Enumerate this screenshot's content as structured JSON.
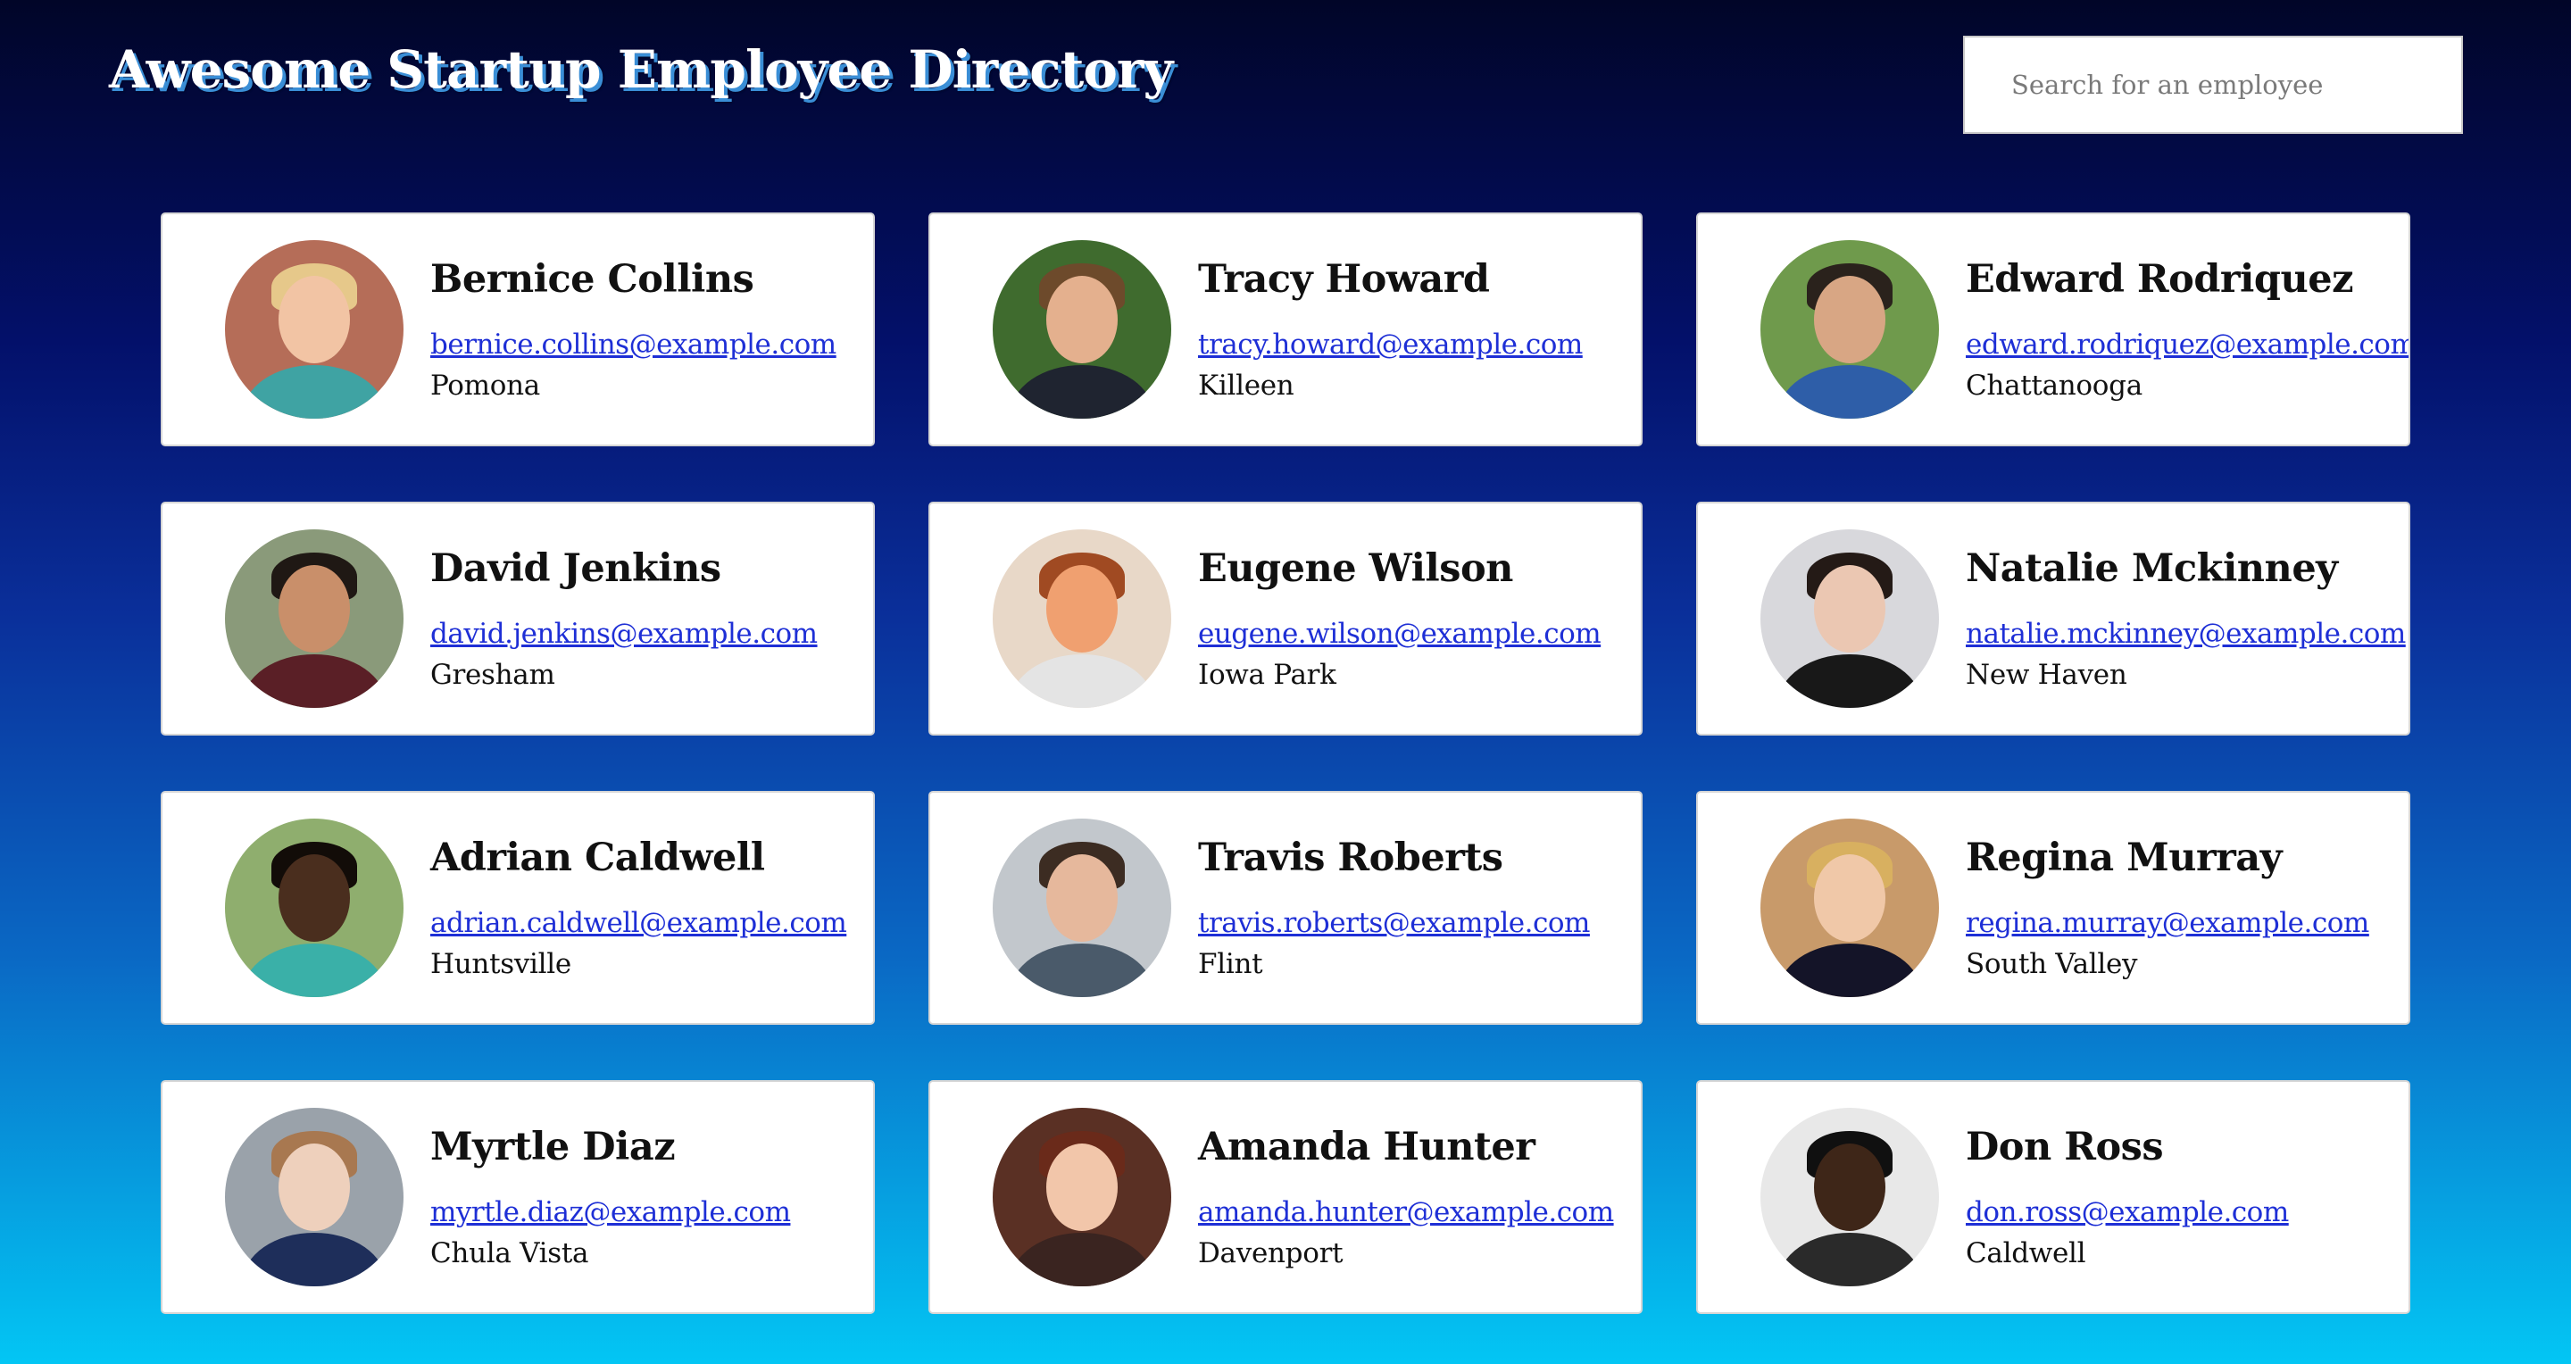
{
  "header": {
    "title": "Awesome Startup Employee Directory",
    "search_placeholder": "Search for an employee"
  },
  "employees": [
    {
      "name": "Bernice Collins",
      "email": "bernice.collins@example.com",
      "city": "Pomona",
      "bg": "#b56d58",
      "skin": "#f2c4a4",
      "hair": "#e6c88a",
      "shirt": "#3fa3a3"
    },
    {
      "name": "Tracy Howard",
      "email": "tracy.howard@example.com",
      "city": "Killeen",
      "bg": "#3f6b2e",
      "skin": "#e4b08e",
      "hair": "#6d4a2b",
      "shirt": "#1f2430"
    },
    {
      "name": "Edward Rodriquez",
      "email": "edward.rodriquez@example.com",
      "city": "Chattanooga",
      "bg": "#6f9a4c",
      "skin": "#d8a684",
      "hair": "#2a221c",
      "shirt": "#2e5ea8"
    },
    {
      "name": "David Jenkins",
      "email": "david.jenkins@example.com",
      "city": "Gresham",
      "bg": "#8a9a7a",
      "skin": "#c98f6a",
      "hair": "#1f1814",
      "shirt": "#5a1f26"
    },
    {
      "name": "Eugene Wilson",
      "email": "eugene.wilson@example.com",
      "city": "Iowa Park",
      "bg": "#e8d8c8",
      "skin": "#f0a070",
      "hair": "#a04a22",
      "shirt": "#e4e4e4"
    },
    {
      "name": "Natalie Mckinney",
      "email": "natalie.mckinney@example.com",
      "city": "New Haven",
      "bg": "#d8d8dc",
      "skin": "#ebc7b2",
      "hair": "#241a16",
      "shirt": "#181818"
    },
    {
      "name": "Adrian Caldwell",
      "email": "adrian.caldwell@example.com",
      "city": "Huntsville",
      "bg": "#8fae6e",
      "skin": "#4a2e1e",
      "hair": "#120c08",
      "shirt": "#3ab0a8"
    },
    {
      "name": "Travis Roberts",
      "email": "travis.roberts@example.com",
      "city": "Flint",
      "bg": "#c2c7cc",
      "skin": "#e6b89c",
      "hair": "#3c2c22",
      "shirt": "#4a5a6a"
    },
    {
      "name": "Regina Murray",
      "email": "regina.murray@example.com",
      "city": "South Valley",
      "bg": "#c89a6a",
      "skin": "#f0c8a8",
      "hair": "#d8b060",
      "shirt": "#141428"
    },
    {
      "name": "Myrtle Diaz",
      "email": "myrtle.diaz@example.com",
      "city": "Chula Vista",
      "bg": "#9aa2aa",
      "skin": "#eed0bc",
      "hair": "#a87850",
      "shirt": "#1e2e5a"
    },
    {
      "name": "Amanda Hunter",
      "email": "amanda.hunter@example.com",
      "city": "Davenport",
      "bg": "#5a3024",
      "skin": "#f2c6aa",
      "hair": "#6a2a1a",
      "shirt": "#3a2420"
    },
    {
      "name": "Don Ross",
      "email": "don.ross@example.com",
      "city": "Caldwell",
      "bg": "#e8e8e8",
      "skin": "#3e2618",
      "hair": "#101010",
      "shirt": "#2a2a2a"
    }
  ]
}
